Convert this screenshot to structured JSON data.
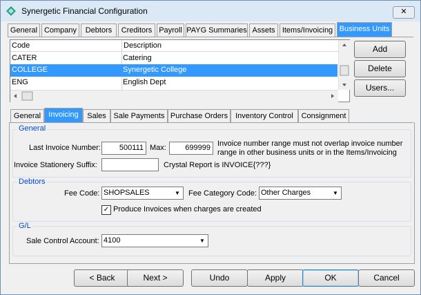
{
  "window": {
    "title": "Synergetic Financial Configuration",
    "close_glyph": "✕"
  },
  "top_tabs": [
    "General",
    "Company",
    "Debtors",
    "Creditors",
    "Payroll",
    "PAYG Summaries",
    "Assets",
    "Items/Invoicing",
    "Business Units"
  ],
  "grid": {
    "columns": [
      "Code",
      "Description"
    ],
    "rows": [
      {
        "code": "CATER",
        "description": "Catering"
      },
      {
        "code": "COLLEGE",
        "description": "Synergetic College"
      },
      {
        "code": "ENG",
        "description": "English Dept"
      }
    ],
    "selected_index": 1
  },
  "side_buttons": {
    "add": "Add",
    "delete": "Delete",
    "users": "Users..."
  },
  "sub_tabs": [
    "General",
    "Invoicing",
    "Sales",
    "Sale Payments",
    "Purchase Orders",
    "Inventory Control",
    "Consignment"
  ],
  "general": {
    "title": "General",
    "last_invoice_label": "Last Invoice Number:",
    "last_invoice_value": "500111",
    "max_label": "Max:",
    "max_value": "699999",
    "note_line1": "Invoice number range must not overlap invoice number",
    "note_line2": "range in other business units or in the Items/Invoicing",
    "stationery_label": "Invoice Stationery Suffix:",
    "stationery_value": "",
    "crystal_text": "Crystal Report is INVOICE{???}"
  },
  "debtors": {
    "title": "Debtors",
    "fee_code_label": "Fee Code:",
    "fee_code_value": "SHOPSALES",
    "fee_cat_label": "Fee Category Code:",
    "fee_cat_value": "Other Charges",
    "produce_label": "Produce Invoices when charges are created",
    "produce_checked": true
  },
  "gl": {
    "title": "G/L",
    "sale_control_label": "Sale Control Account:",
    "sale_control_value": "4100"
  },
  "bottom_buttons": {
    "back": "< Back",
    "next": "Next >",
    "undo": "Undo",
    "apply": "Apply",
    "ok": "OK",
    "cancel": "Cancel"
  },
  "colors": {
    "selection": "#3399ff",
    "group_title": "#0046d5"
  }
}
